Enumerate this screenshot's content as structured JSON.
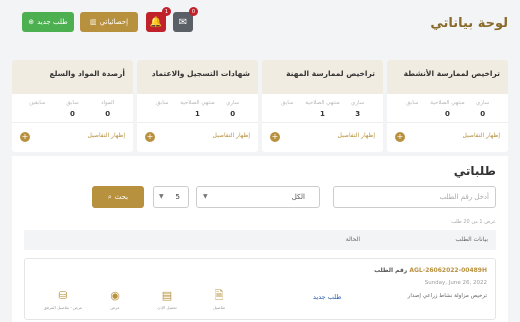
{
  "header": {
    "title": "لوحة بياناتي",
    "new_request_label": "طلب جديد",
    "stats_label": "إحصائياتي",
    "bell_count": "1",
    "mail_count": "0"
  },
  "cards": [
    {
      "title": "تراخيص لممارسة الأنشطة",
      "labels": [
        "ساري",
        "منتهي الصلاحية",
        "سابق"
      ],
      "values": [
        "0",
        "0",
        ""
      ],
      "details": "إظهار التفاصيل"
    },
    {
      "title": "تراخيص لممارسة المهنة",
      "labels": [
        "ساري",
        "منتهي الصلاحية",
        "سابق"
      ],
      "values": [
        "3",
        "1",
        ""
      ],
      "details": "إظهار التفاصيل"
    },
    {
      "title": "شهادات التسجيل والاعتماد",
      "labels": [
        "ساري",
        "منتهي الصلاحية",
        "سابق"
      ],
      "values": [
        "0",
        "1",
        ""
      ],
      "details": "إظهار التفاصيل"
    },
    {
      "title": "أرصدة المواد والسلع",
      "labels": [
        "المواد",
        "سابق",
        "سابقين"
      ],
      "values": [
        "0",
        "0",
        ""
      ],
      "details": "إظهار التفاصيل"
    }
  ],
  "requests": {
    "title": "طلباتي",
    "search_placeholder": "أدخل رقم الطلب",
    "status_filter": "الكل",
    "page_size": "5",
    "search_button": "بحث",
    "info": "عرض 1 من 20 طلب",
    "col_data": "بيانات الطلب",
    "col_status": "الحالة",
    "rows": [
      {
        "number_label": "رقم الطلب",
        "number": "AGL-26062022-00489H",
        "date": "Sunday, June 26, 2022",
        "type": "ترخيص مزاولة نشاط زراعي إصدار",
        "status": "طلب جديد",
        "actions": [
          "تفاصيل",
          "تحميل الإذن",
          "عرض",
          "عرض - تفاصيل المرفق"
        ]
      }
    ]
  },
  "colors": {
    "gold": "#b8913e",
    "green": "#4caf50",
    "red": "#c0212a",
    "blue": "#2a5db0"
  },
  "icons": {
    "new": "plus-circle-icon",
    "stats": "chart-icon",
    "bell": "bell-icon",
    "mail": "mail-icon",
    "search": "search-icon"
  }
}
